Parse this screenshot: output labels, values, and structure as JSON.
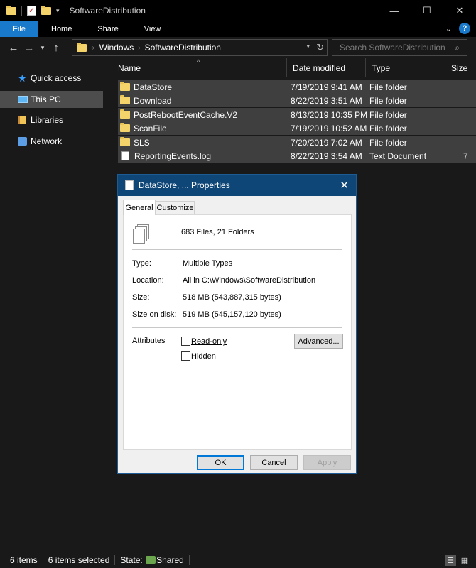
{
  "window": {
    "title": "SoftwareDistribution",
    "controls": {
      "minimize": "—",
      "maximize": "☐",
      "close": "✕"
    }
  },
  "ribbon": {
    "tabs": [
      "File",
      "Home",
      "Share",
      "View"
    ],
    "collapse": "⌄",
    "help": "?"
  },
  "address": {
    "overflow": "«",
    "crumbs": [
      "Windows",
      "SoftwareDistribution"
    ],
    "separator": "›",
    "search_placeholder": "Search SoftwareDistribution"
  },
  "nav": {
    "items": [
      {
        "label": "Quick access",
        "icon": "star-icon"
      },
      {
        "label": "This PC",
        "icon": "computer-icon",
        "selected": true
      },
      {
        "label": "Libraries",
        "icon": "library-icon"
      },
      {
        "label": "Network",
        "icon": "network-icon"
      }
    ]
  },
  "filelist": {
    "columns": [
      "Name",
      "Date modified",
      "Type",
      "Size"
    ],
    "sort_indicator": "^",
    "rows": [
      {
        "name": "DataStore",
        "date": "7/19/2019 9:41 AM",
        "type": "File folder",
        "size": "",
        "icon": "folder-icon",
        "selected": true
      },
      {
        "name": "Download",
        "date": "8/22/2019 3:51 AM",
        "type": "File folder",
        "size": "",
        "icon": "folder-icon",
        "selected": true
      },
      {
        "name": "PostRebootEventCache.V2",
        "date": "8/13/2019 10:35 PM",
        "type": "File folder",
        "size": "",
        "icon": "folder-icon",
        "selected": true
      },
      {
        "name": "ScanFile",
        "date": "7/19/2019 10:52 AM",
        "type": "File folder",
        "size": "",
        "icon": "folder-icon",
        "selected": true
      },
      {
        "name": "SLS",
        "date": "7/20/2019 7:02 AM",
        "type": "File folder",
        "size": "",
        "icon": "folder-icon",
        "selected": true
      },
      {
        "name": "ReportingEvents.log",
        "date": "8/22/2019 3:54 AM",
        "type": "Text Document",
        "size": "7",
        "icon": "document-icon",
        "selected": true
      }
    ]
  },
  "status": {
    "items_count": "6 items",
    "selected_count": "6 items selected",
    "state_label": "State:",
    "state_value": "Shared"
  },
  "dialog": {
    "title": "DataStore, ... Properties",
    "tabs": [
      "General",
      "Customize"
    ],
    "summary": "683 Files, 21 Folders",
    "type_label": "Type:",
    "type_value": "Multiple Types",
    "location_label": "Location:",
    "location_value": "All in C:\\Windows\\SoftwareDistribution",
    "size_label": "Size:",
    "size_value": "518 MB (543,887,315 bytes)",
    "size_on_disk_label": "Size on disk:",
    "size_on_disk_value": "519 MB (545,157,120 bytes)",
    "attributes_label": "Attributes",
    "readonly_label": "Read-only",
    "hidden_label": "Hidden",
    "advanced_label": "Advanced...",
    "ok_label": "OK",
    "cancel_label": "Cancel",
    "apply_label": "Apply"
  }
}
